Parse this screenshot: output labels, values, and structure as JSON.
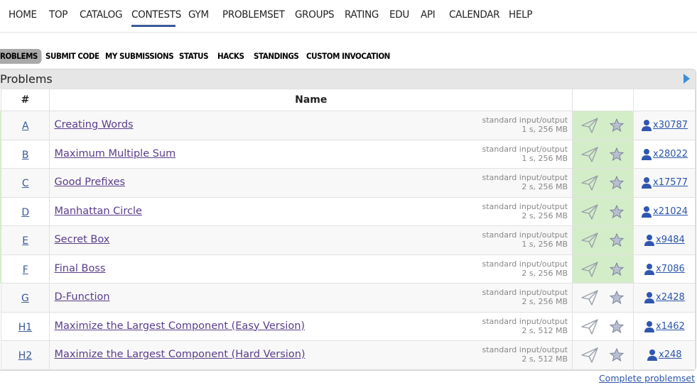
{
  "nav": {
    "items": [
      {
        "label": "HOME",
        "x": 0
      },
      {
        "label": "TOP",
        "x": 0
      },
      {
        "label": "CATALOG",
        "x": 0
      },
      {
        "label": "CONTESTS",
        "x": 0
      },
      {
        "label": "GYM",
        "x": 0
      },
      {
        "label": "PROBLEMSET",
        "x": 0
      },
      {
        "label": "GROUPS",
        "x": 0
      },
      {
        "label": "RATING",
        "x": 0
      },
      {
        "label": "EDU",
        "x": 0
      },
      {
        "label": "API",
        "x": 0
      },
      {
        "label": "CALENDAR",
        "x": 0
      },
      {
        "label": "HELP",
        "x": 0
      }
    ],
    "active": "CONTESTS"
  },
  "subnav": {
    "items": [
      "ROBLEMS",
      "SUBMIT CODE",
      "MY SUBMISSIONS",
      "STATUS",
      "HACKS",
      "STANDINGS",
      "CUSTOM INVOCATION"
    ],
    "selected": "ROBLEMS"
  },
  "problems": {
    "caption": "Problems",
    "headers": {
      "id": "#",
      "name": "Name"
    },
    "rows": [
      {
        "id": "A",
        "name": "Creating Words",
        "io": "standard input/output",
        "limits": "1 s, 256 MB",
        "solved": "x30787",
        "accepted": true
      },
      {
        "id": "B",
        "name": "Maximum Multiple Sum",
        "io": "standard input/output",
        "limits": "1 s, 256 MB",
        "solved": "x28022",
        "accepted": true
      },
      {
        "id": "C",
        "name": "Good Prefixes",
        "io": "standard input/output",
        "limits": "2 s, 256 MB",
        "solved": "x17577",
        "accepted": true
      },
      {
        "id": "D",
        "name": "Manhattan Circle",
        "io": "standard input/output",
        "limits": "2 s, 256 MB",
        "solved": "x21024",
        "accepted": true
      },
      {
        "id": "E",
        "name": "Secret Box",
        "io": "standard input/output",
        "limits": "1 s, 256 MB",
        "solved": "x9484",
        "accepted": true
      },
      {
        "id": "F",
        "name": "Final Boss",
        "io": "standard input/output",
        "limits": "2 s, 256 MB",
        "solved": "x7086",
        "accepted": true
      },
      {
        "id": "G",
        "name": "D-Function",
        "io": "standard input/output",
        "limits": "2 s, 256 MB",
        "solved": "x2428",
        "accepted": false
      },
      {
        "id": "H1",
        "name": "Maximize the Largest Component (Easy Version)",
        "io": "standard input/output",
        "limits": "2 s, 512 MB",
        "solved": "x1462",
        "accepted": false
      },
      {
        "id": "H2",
        "name": "Maximize the Largest Component (Hard Version)",
        "io": "standard input/output",
        "limits": "2 s, 512 MB",
        "solved": "x248",
        "accepted": false
      }
    ]
  },
  "footer": {
    "complete_problemset": "Complete problemset"
  },
  "colors": {
    "link": "#2b55a9",
    "problem_link": "#5a3d8a",
    "accepted_bg": "#d4edc9",
    "accent": "#3b5998"
  },
  "icons": {
    "submit": "send-icon",
    "favourite": "star-icon",
    "solved": "user-icon",
    "toggle": "triangle-right-icon"
  }
}
